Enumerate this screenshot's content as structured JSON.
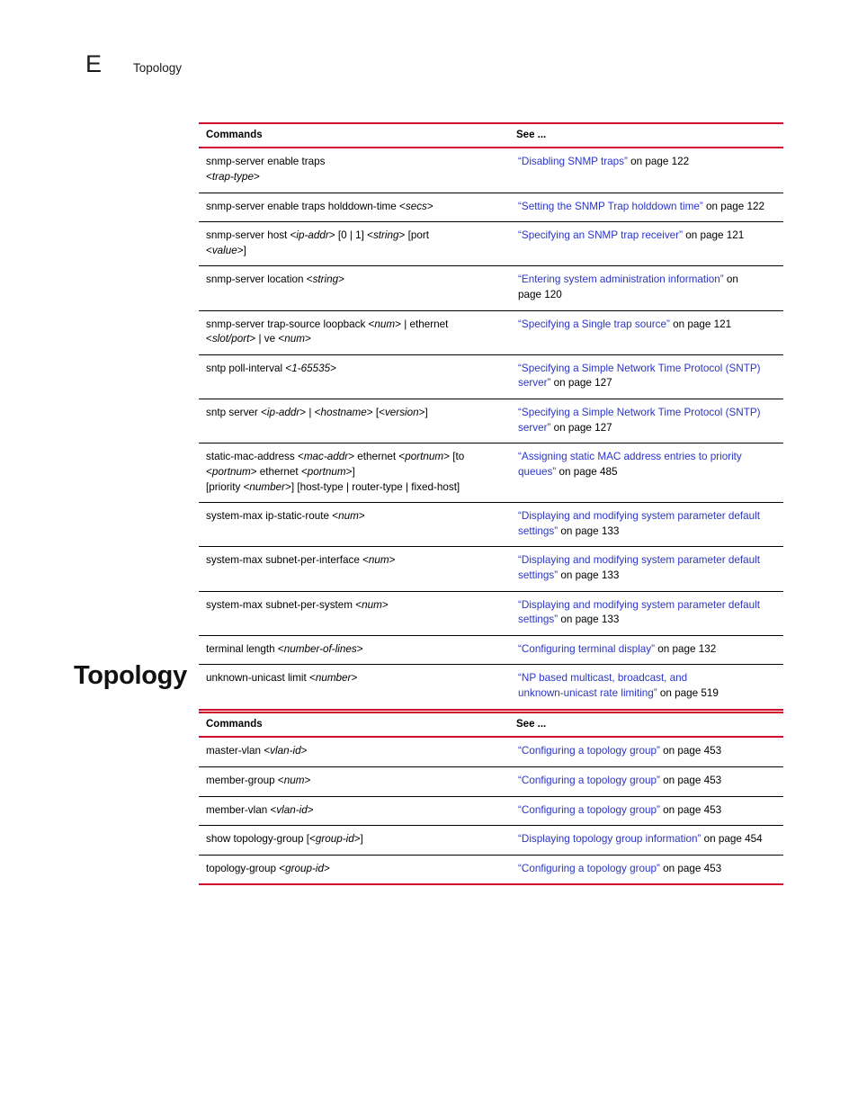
{
  "header": {
    "appendix_letter": "E",
    "title": "Topology"
  },
  "section": {
    "heading": "Topology"
  },
  "tables": [
    {
      "id": "table-1",
      "columns": {
        "commands": "Commands",
        "see": "See ..."
      },
      "rows": [
        {
          "command": "snmp-server enable traps\n<trap-type>",
          "link": "“Disabling SNMP traps”",
          "tail": " on page 122"
        },
        {
          "command": "snmp-server enable traps holddown-time <secs>",
          "link": "“Setting the SNMP Trap holddown time”",
          "tail": " on page 122"
        },
        {
          "command": "snmp-server host <ip-addr> [0 | 1] <string> [port\n<value>]",
          "link": "“Specifying an SNMP trap receiver”",
          "tail": " on page 121"
        },
        {
          "command": "snmp-server location <string>",
          "link": "“Entering system administration information”",
          "tail": " on\npage 120"
        },
        {
          "command": "snmp-server trap-source loopback <num> | ethernet\n<slot/port> | ve <num>",
          "link": "“Specifying a Single trap source”",
          "tail": " on page 121"
        },
        {
          "command": "sntp poll-interval <1-65535>",
          "link": "“Specifying a Simple Network Time Protocol (SNTP)\nserver”",
          "tail": " on page 127"
        },
        {
          "command": "sntp server <ip-addr> | <hostname> [<version>]",
          "link": "“Specifying a Simple Network Time Protocol (SNTP)\nserver”",
          "tail": " on page 127"
        },
        {
          "command": "static-mac-address <mac-addr> ethernet <portnum> [to\n<portnum> ethernet <portnum>]\n[priority <number>] [host-type | router-type | fixed-host]",
          "link": " “Assigning static MAC address entries to priority\nqueues”",
          "tail": " on page 485"
        },
        {
          "command": "system-max ip-static-route <num>",
          "link": "“Displaying and modifying system parameter default\nsettings”",
          "tail": " on page 133"
        },
        {
          "command": "system-max subnet-per-interface <num>",
          "link": "“Displaying and modifying system parameter default\nsettings”",
          "tail": " on page 133"
        },
        {
          "command": "system-max subnet-per-system <num>",
          "link": "“Displaying and modifying system parameter default\nsettings”",
          "tail": " on page 133"
        },
        {
          "command": "terminal length <number-of-lines>",
          "link": "“Configuring terminal display”",
          "tail": " on page 132"
        },
        {
          "command": "unknown-unicast limit <number>",
          "link": "“NP based multicast, broadcast, and\nunknown-unicast rate limiting”",
          "tail": " on page 519"
        }
      ]
    },
    {
      "id": "table-2",
      "columns": {
        "commands": "Commands",
        "see": "See ..."
      },
      "rows": [
        {
          "command": "master-vlan <vlan-id>",
          "link": "“Configuring a topology group”",
          "tail": " on page 453"
        },
        {
          "command": "member-group <num>",
          "link": "“Configuring a topology group”",
          "tail": " on page 453"
        },
        {
          "command": "member-vlan <vlan-id>",
          "link": "“Configuring a topology group”",
          "tail": " on page 453"
        },
        {
          "command": "show topology-group [<group-id>]",
          "link": "“Displaying topology group information”",
          "tail": " on page 454"
        },
        {
          "command": "topology-group <group-id>",
          "link": "“Configuring a topology group”",
          "tail": " on page 453"
        }
      ]
    }
  ],
  "colors": {
    "rule_red": "#cf0a2c",
    "link_blue": "#2b35c8",
    "row_rule": "#000000"
  }
}
